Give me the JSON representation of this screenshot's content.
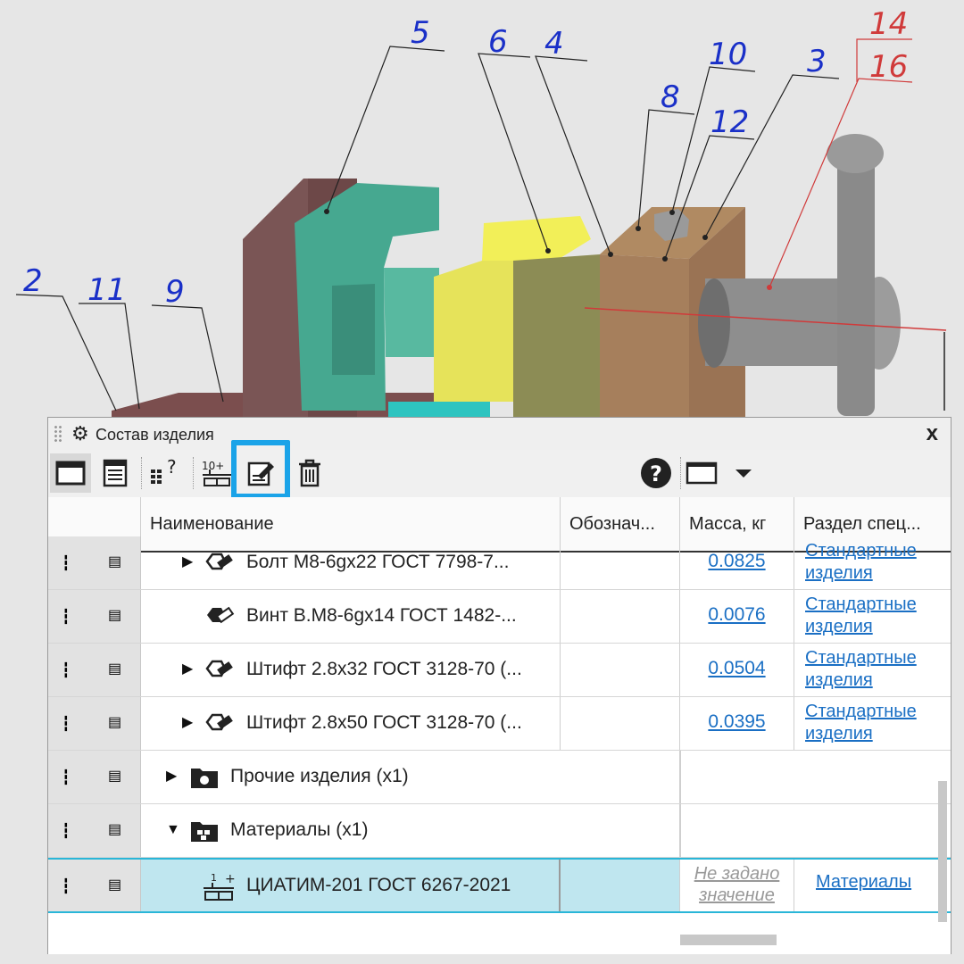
{
  "drawing": {
    "callouts": [
      "5",
      "6",
      "4",
      "10",
      "8",
      "12",
      "3",
      "14",
      "16",
      "2",
      "11",
      "9"
    ]
  },
  "panel": {
    "title": "Состав изделия",
    "close_label": "x",
    "toolbar": [
      {
        "icon": "window-view-icon",
        "active": true
      },
      {
        "icon": "table-view-icon"
      },
      {
        "icon": "calculator-help-icon",
        "label": "?"
      },
      {
        "icon": "add-material-icon",
        "label": "10+"
      },
      {
        "icon": "edit-object-icon",
        "highlighted": true
      },
      {
        "icon": "delete-icon"
      },
      {
        "icon": "help-icon",
        "label": "?"
      },
      {
        "icon": "layout-dropdown-icon"
      }
    ],
    "highlight_color": "#1aa3e8",
    "columns": [
      "Наименование",
      "Обознач...",
      "Масса, кг",
      "Раздел спец..."
    ],
    "rows": [
      {
        "expander": "▶",
        "icon": "bolt-group-icon",
        "name": "Болт М8-6gx22 ГОСТ 7798-7...",
        "mass": "0.0825",
        "section": "Стандартные изделия"
      },
      {
        "expander": "",
        "icon": "screw-icon",
        "name": "Винт В.М8-6gx14 ГОСТ 1482-...",
        "mass": "0.0076",
        "section": "Стандартные изделия"
      },
      {
        "expander": "▶",
        "icon": "pin-group-icon",
        "name": "Штифт 2.8x32 ГОСТ 3128-70 (...",
        "mass": "0.0504",
        "section": "Стандартные изделия"
      },
      {
        "expander": "▶",
        "icon": "pin-group-icon",
        "name": "Штифт 2.8x50 ГОСТ 3128-70 (...",
        "mass": "0.0395",
        "section": "Стандартные изделия"
      },
      {
        "expander": "▶",
        "icon": "other-products-folder-icon",
        "name": "Прочие изделия (x1)",
        "mass": "",
        "section": ""
      },
      {
        "expander": "▼",
        "icon": "materials-folder-icon",
        "name": "Материалы (x1)",
        "mass": "",
        "section": ""
      },
      {
        "expander": "",
        "icon": "material-item-icon",
        "name": "ЦИАТИМ-201 ГОСТ 6267-2021",
        "mass_placeholder": "Не задано значение",
        "section": "Материалы",
        "selected": true
      }
    ]
  }
}
